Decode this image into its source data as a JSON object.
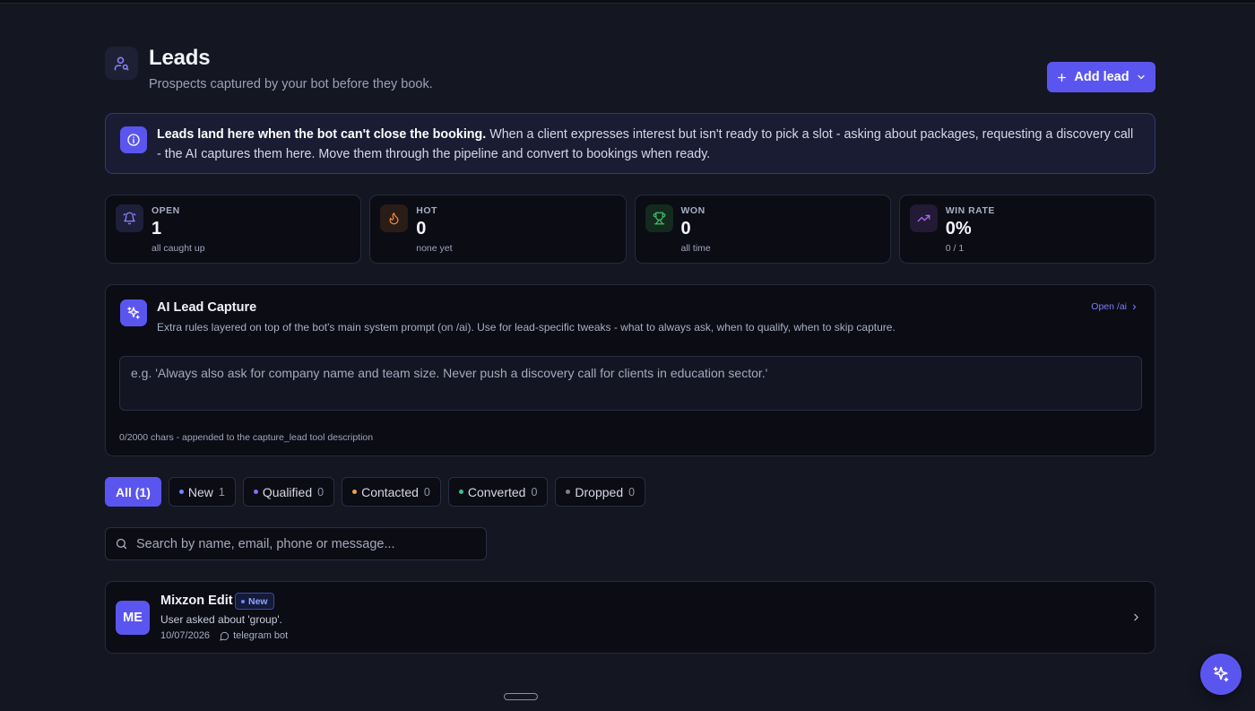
{
  "header": {
    "title": "Leads",
    "subtitle": "Prospects captured by your bot before they book.",
    "icon": "user-search-icon",
    "add_lead_label": "Add lead"
  },
  "info_banner": {
    "bold": "Leads land here when the bot can't close the booking.",
    "text": " When a client expresses interest but isn't ready to pick a slot - asking about packages, requesting a discovery call - the AI captures them here. Move them through the pipeline and convert to bookings when ready."
  },
  "stats": [
    {
      "label": "OPEN",
      "value": "1",
      "sub": "all caught up",
      "icon": "bell-icon",
      "color": "#8a86ff"
    },
    {
      "label": "HOT",
      "value": "0",
      "sub": "none yet",
      "icon": "flame-icon",
      "color": "#f08a3c"
    },
    {
      "label": "WON",
      "value": "0",
      "sub": "all time",
      "icon": "trophy-icon",
      "color": "#3fbf6b"
    },
    {
      "label": "WIN RATE",
      "value": "0%",
      "sub": "0 / 1",
      "icon": "trending-up-icon",
      "color": "#b06cf5"
    }
  ],
  "ai_capture": {
    "title": "AI Lead Capture",
    "description": "Extra rules layered on top of the bot's main system prompt (on /ai). Use for lead-specific tweaks - what to always ask, when to qualify, when to skip capture.",
    "open_link": "Open /ai",
    "placeholder": "e.g. 'Always also ask for company name and team size. Never push a discovery call for clients in education sector.'",
    "value": "",
    "hint": "0/2000 chars - appended to the capture_lead tool description"
  },
  "filters": [
    {
      "label": "All (1)",
      "count": "",
      "active": true,
      "dot": ""
    },
    {
      "label": "New",
      "count": "1",
      "active": false,
      "dot": "#6f86ff"
    },
    {
      "label": "Qualified",
      "count": "0",
      "active": false,
      "dot": "#8a6cff"
    },
    {
      "label": "Contacted",
      "count": "0",
      "active": false,
      "dot": "#f0a23c"
    },
    {
      "label": "Converted",
      "count": "0",
      "active": false,
      "dot": "#3fbf8b"
    },
    {
      "label": "Dropped",
      "count": "0",
      "active": false,
      "dot": "#7a7f92"
    }
  ],
  "search": {
    "placeholder": "Search by name, email, phone or message...",
    "value": ""
  },
  "leads": [
    {
      "initials": "ME",
      "name": "Mixzon Edit",
      "status": "New",
      "message": "User asked about 'group'.",
      "date": "10/07/2026",
      "source": "telegram bot"
    }
  ],
  "colors": {
    "accent": "#5b55f0",
    "background": "#141622",
    "card": "#0b0c14"
  }
}
